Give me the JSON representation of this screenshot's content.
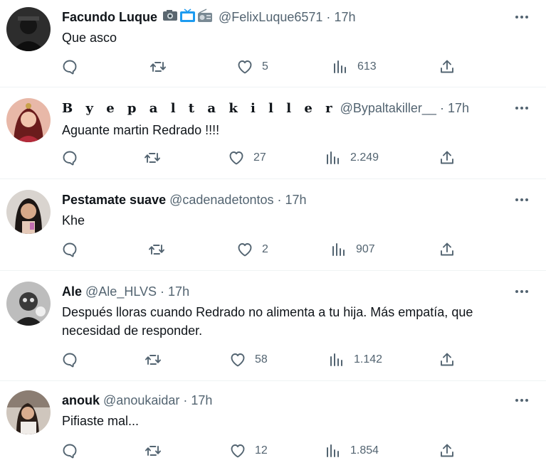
{
  "replies": [
    {
      "name": "Facundo Luque",
      "name_emojis": [
        "camera-emoji",
        "tv-emoji",
        "radio-emoji"
      ],
      "handle": "@FelixLuque6571",
      "dot": "·",
      "time": "17h",
      "text": "Que asco",
      "likes": "5",
      "views": "613"
    },
    {
      "name": "B y e p a l t a k i l l e r",
      "handle": "@Bypaltakiller__",
      "dot": "·",
      "time": "17h",
      "text": "Aguante martin Redrado !!!!",
      "likes": "27",
      "views": "2.249"
    },
    {
      "name": "Pestamate suave",
      "handle": "@cadenadetontos",
      "dot": "·",
      "time": "17h",
      "text": "Khe",
      "likes": "2",
      "views": "907"
    },
    {
      "name": "Ale",
      "handle": "@Ale_HLVS",
      "dot": "·",
      "time": "17h",
      "text": "Después lloras cuando Redrado no alimenta a tu hija. Más empatía, que necesidad de responder.",
      "likes": "58",
      "views": "1.142"
    },
    {
      "name": "anouk",
      "handle": "@anoukaidar",
      "dot": "·",
      "time": "17h",
      "text": "Pifiaste mal...",
      "likes": "12",
      "views": "1.854"
    }
  ],
  "colors": {
    "text": "#0f1419",
    "secondary": "#536471",
    "divider": "#eff3f4"
  },
  "icons": [
    "reply-icon",
    "retweet-icon",
    "like-icon",
    "views-icon",
    "share-icon",
    "more-icon"
  ]
}
